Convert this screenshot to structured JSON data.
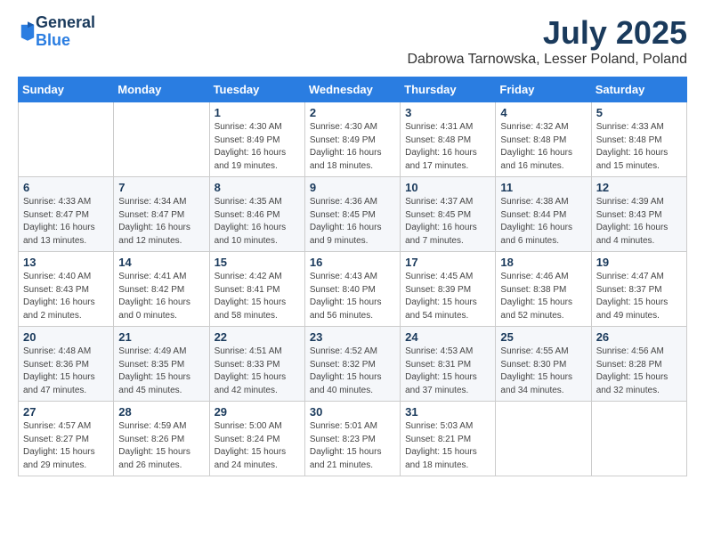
{
  "logo": {
    "general": "General",
    "blue": "Blue"
  },
  "title": "July 2025",
  "subtitle": "Dabrowa Tarnowska, Lesser Poland, Poland",
  "days_of_week": [
    "Sunday",
    "Monday",
    "Tuesday",
    "Wednesday",
    "Thursday",
    "Friday",
    "Saturday"
  ],
  "weeks": [
    [
      {
        "day": "",
        "detail": ""
      },
      {
        "day": "",
        "detail": ""
      },
      {
        "day": "1",
        "detail": "Sunrise: 4:30 AM\nSunset: 8:49 PM\nDaylight: 16 hours\nand 19 minutes."
      },
      {
        "day": "2",
        "detail": "Sunrise: 4:30 AM\nSunset: 8:49 PM\nDaylight: 16 hours\nand 18 minutes."
      },
      {
        "day": "3",
        "detail": "Sunrise: 4:31 AM\nSunset: 8:48 PM\nDaylight: 16 hours\nand 17 minutes."
      },
      {
        "day": "4",
        "detail": "Sunrise: 4:32 AM\nSunset: 8:48 PM\nDaylight: 16 hours\nand 16 minutes."
      },
      {
        "day": "5",
        "detail": "Sunrise: 4:33 AM\nSunset: 8:48 PM\nDaylight: 16 hours\nand 15 minutes."
      }
    ],
    [
      {
        "day": "6",
        "detail": "Sunrise: 4:33 AM\nSunset: 8:47 PM\nDaylight: 16 hours\nand 13 minutes."
      },
      {
        "day": "7",
        "detail": "Sunrise: 4:34 AM\nSunset: 8:47 PM\nDaylight: 16 hours\nand 12 minutes."
      },
      {
        "day": "8",
        "detail": "Sunrise: 4:35 AM\nSunset: 8:46 PM\nDaylight: 16 hours\nand 10 minutes."
      },
      {
        "day": "9",
        "detail": "Sunrise: 4:36 AM\nSunset: 8:45 PM\nDaylight: 16 hours\nand 9 minutes."
      },
      {
        "day": "10",
        "detail": "Sunrise: 4:37 AM\nSunset: 8:45 PM\nDaylight: 16 hours\nand 7 minutes."
      },
      {
        "day": "11",
        "detail": "Sunrise: 4:38 AM\nSunset: 8:44 PM\nDaylight: 16 hours\nand 6 minutes."
      },
      {
        "day": "12",
        "detail": "Sunrise: 4:39 AM\nSunset: 8:43 PM\nDaylight: 16 hours\nand 4 minutes."
      }
    ],
    [
      {
        "day": "13",
        "detail": "Sunrise: 4:40 AM\nSunset: 8:43 PM\nDaylight: 16 hours\nand 2 minutes."
      },
      {
        "day": "14",
        "detail": "Sunrise: 4:41 AM\nSunset: 8:42 PM\nDaylight: 16 hours\nand 0 minutes."
      },
      {
        "day": "15",
        "detail": "Sunrise: 4:42 AM\nSunset: 8:41 PM\nDaylight: 15 hours\nand 58 minutes."
      },
      {
        "day": "16",
        "detail": "Sunrise: 4:43 AM\nSunset: 8:40 PM\nDaylight: 15 hours\nand 56 minutes."
      },
      {
        "day": "17",
        "detail": "Sunrise: 4:45 AM\nSunset: 8:39 PM\nDaylight: 15 hours\nand 54 minutes."
      },
      {
        "day": "18",
        "detail": "Sunrise: 4:46 AM\nSunset: 8:38 PM\nDaylight: 15 hours\nand 52 minutes."
      },
      {
        "day": "19",
        "detail": "Sunrise: 4:47 AM\nSunset: 8:37 PM\nDaylight: 15 hours\nand 49 minutes."
      }
    ],
    [
      {
        "day": "20",
        "detail": "Sunrise: 4:48 AM\nSunset: 8:36 PM\nDaylight: 15 hours\nand 47 minutes."
      },
      {
        "day": "21",
        "detail": "Sunrise: 4:49 AM\nSunset: 8:35 PM\nDaylight: 15 hours\nand 45 minutes."
      },
      {
        "day": "22",
        "detail": "Sunrise: 4:51 AM\nSunset: 8:33 PM\nDaylight: 15 hours\nand 42 minutes."
      },
      {
        "day": "23",
        "detail": "Sunrise: 4:52 AM\nSunset: 8:32 PM\nDaylight: 15 hours\nand 40 minutes."
      },
      {
        "day": "24",
        "detail": "Sunrise: 4:53 AM\nSunset: 8:31 PM\nDaylight: 15 hours\nand 37 minutes."
      },
      {
        "day": "25",
        "detail": "Sunrise: 4:55 AM\nSunset: 8:30 PM\nDaylight: 15 hours\nand 34 minutes."
      },
      {
        "day": "26",
        "detail": "Sunrise: 4:56 AM\nSunset: 8:28 PM\nDaylight: 15 hours\nand 32 minutes."
      }
    ],
    [
      {
        "day": "27",
        "detail": "Sunrise: 4:57 AM\nSunset: 8:27 PM\nDaylight: 15 hours\nand 29 minutes."
      },
      {
        "day": "28",
        "detail": "Sunrise: 4:59 AM\nSunset: 8:26 PM\nDaylight: 15 hours\nand 26 minutes."
      },
      {
        "day": "29",
        "detail": "Sunrise: 5:00 AM\nSunset: 8:24 PM\nDaylight: 15 hours\nand 24 minutes."
      },
      {
        "day": "30",
        "detail": "Sunrise: 5:01 AM\nSunset: 8:23 PM\nDaylight: 15 hours\nand 21 minutes."
      },
      {
        "day": "31",
        "detail": "Sunrise: 5:03 AM\nSunset: 8:21 PM\nDaylight: 15 hours\nand 18 minutes."
      },
      {
        "day": "",
        "detail": ""
      },
      {
        "day": "",
        "detail": ""
      }
    ]
  ]
}
